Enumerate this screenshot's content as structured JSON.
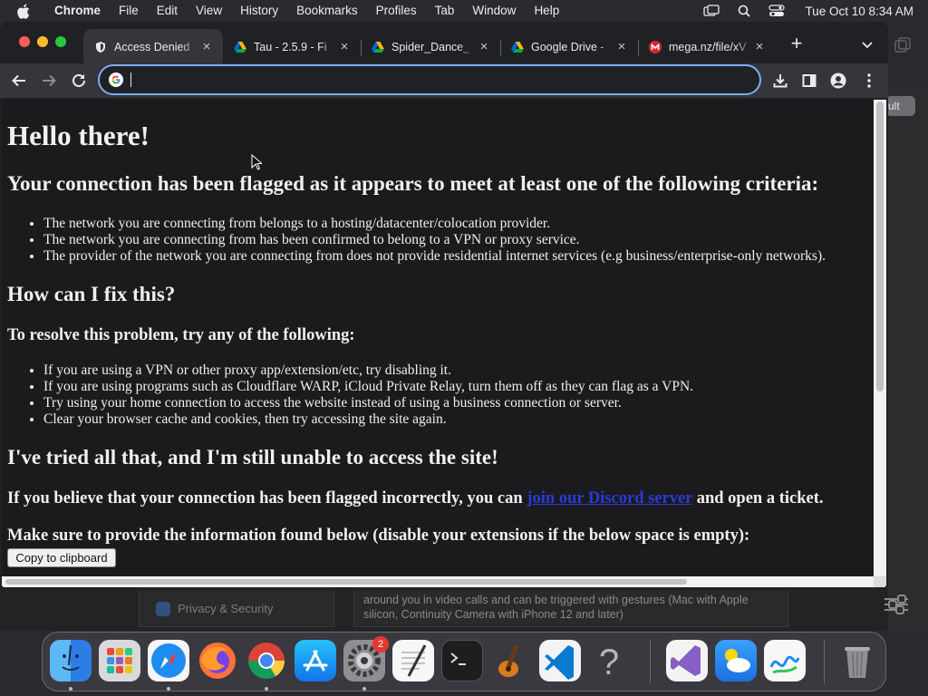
{
  "menubar": {
    "app_name": "Chrome",
    "items": [
      "File",
      "Edit",
      "View",
      "History",
      "Bookmarks",
      "Profiles",
      "Tab",
      "Window",
      "Help"
    ],
    "clock": "Tue Oct 10  8:34 AM"
  },
  "tabs": [
    {
      "title": "Access Denied",
      "favicon": "shield-icon",
      "active": true
    },
    {
      "title": "Tau - 2.5.9 - Fi",
      "favicon": "google-drive-icon",
      "active": false
    },
    {
      "title": "Spider_Dance_",
      "favicon": "google-drive-icon",
      "active": false
    },
    {
      "title": "Google Drive - ",
      "favicon": "google-drive-icon",
      "active": false
    },
    {
      "title": "mega.nz/file/xV",
      "favicon": "mega-icon",
      "active": false
    }
  ],
  "omnibox": {
    "value": "",
    "placeholder": ""
  },
  "page": {
    "heading": "Hello there!",
    "flagged_heading": "Your connection has been flagged as it appears to meet at least one of the following criteria:",
    "criteria": [
      "The network you are connecting from belongs to a hosting/datacenter/colocation provider.",
      "The network you are connecting from has been confirmed to belong to a VPN or proxy service.",
      "The provider of the network you are connecting from does not provide residential internet services (e.g business/enterprise-only networks)."
    ],
    "fix_heading": "How can I fix this?",
    "resolve_heading": "To resolve this problem, try any of the following:",
    "fixes": [
      "If you are using a VPN or other proxy app/extension/etc, try disabling it.",
      "If you are using programs such as Cloudflare WARP, iCloud Private Relay, turn them off as they can flag as a VPN.",
      "Try using your home connection to access the website instead of using a business connection or server.",
      "Clear your browser cache and cookies, then try accessing the site again."
    ],
    "tried_heading": "I've tried all that, and I'm still unable to access the site!",
    "incorrect_prefix": "If you believe that your connection has been flagged incorrectly, you can",
    "discord_link": "join our Discord server",
    "incorrect_suffix": "and open a ticket.",
    "provide_info": "Make sure to provide the information found below (disable your extensions if the below space is empty):",
    "copy_button": "Copy to clipboard"
  },
  "background": {
    "button_partial": "ult",
    "privacy_label": "Privacy & Security",
    "description": "around you in video calls and can be triggered with gestures (Mac with Apple silicon, Continuity Camera with iPhone 12 and later)"
  },
  "dock": {
    "apps": [
      "Finder",
      "Launchpad",
      "Safari",
      "Firefox",
      "Chrome",
      "App Store",
      "System Settings",
      "TextEdit",
      "Terminal",
      "GarageBand",
      "Visual Studio Code",
      "Help",
      "Visual Studio",
      "Weather",
      "Freeform",
      "Trash"
    ],
    "settings_badge": "2"
  }
}
